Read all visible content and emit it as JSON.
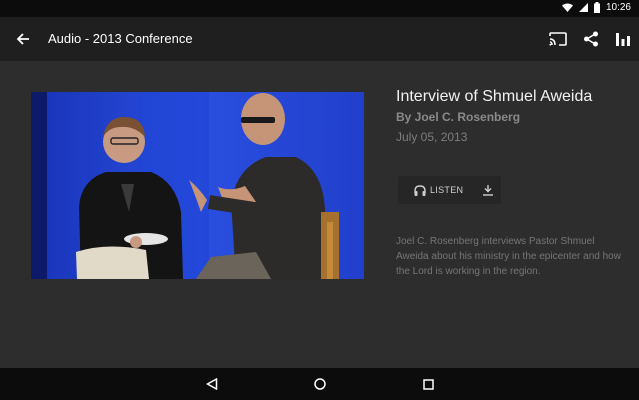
{
  "status_bar": {
    "time": "10:26",
    "icons": [
      "wifi-icon",
      "cell-signal-icon",
      "battery-icon"
    ]
  },
  "app_bar": {
    "title": "Audio - 2013 Conference",
    "actions": [
      "cast-icon",
      "share-icon",
      "equalizer-icon"
    ]
  },
  "item": {
    "title": "Interview of Shmuel Aweida",
    "author": "By Joel C. Rosenberg",
    "date": "July 05, 2013",
    "listen_label": "LISTEN",
    "description": "Joel C. Rosenberg interviews Pastor Shmuel Aweida about his ministry in the epicenter and how the Lord is working in the region."
  },
  "nav_bar": {
    "buttons": [
      "back-triangle-icon",
      "home-circle-icon",
      "recents-square-icon"
    ]
  },
  "colors": {
    "background": "#2d2d2d",
    "app_bar": "#1f1f1f",
    "system_bars": "#0c0c0c",
    "stage_blue": "#1f3fd1"
  }
}
